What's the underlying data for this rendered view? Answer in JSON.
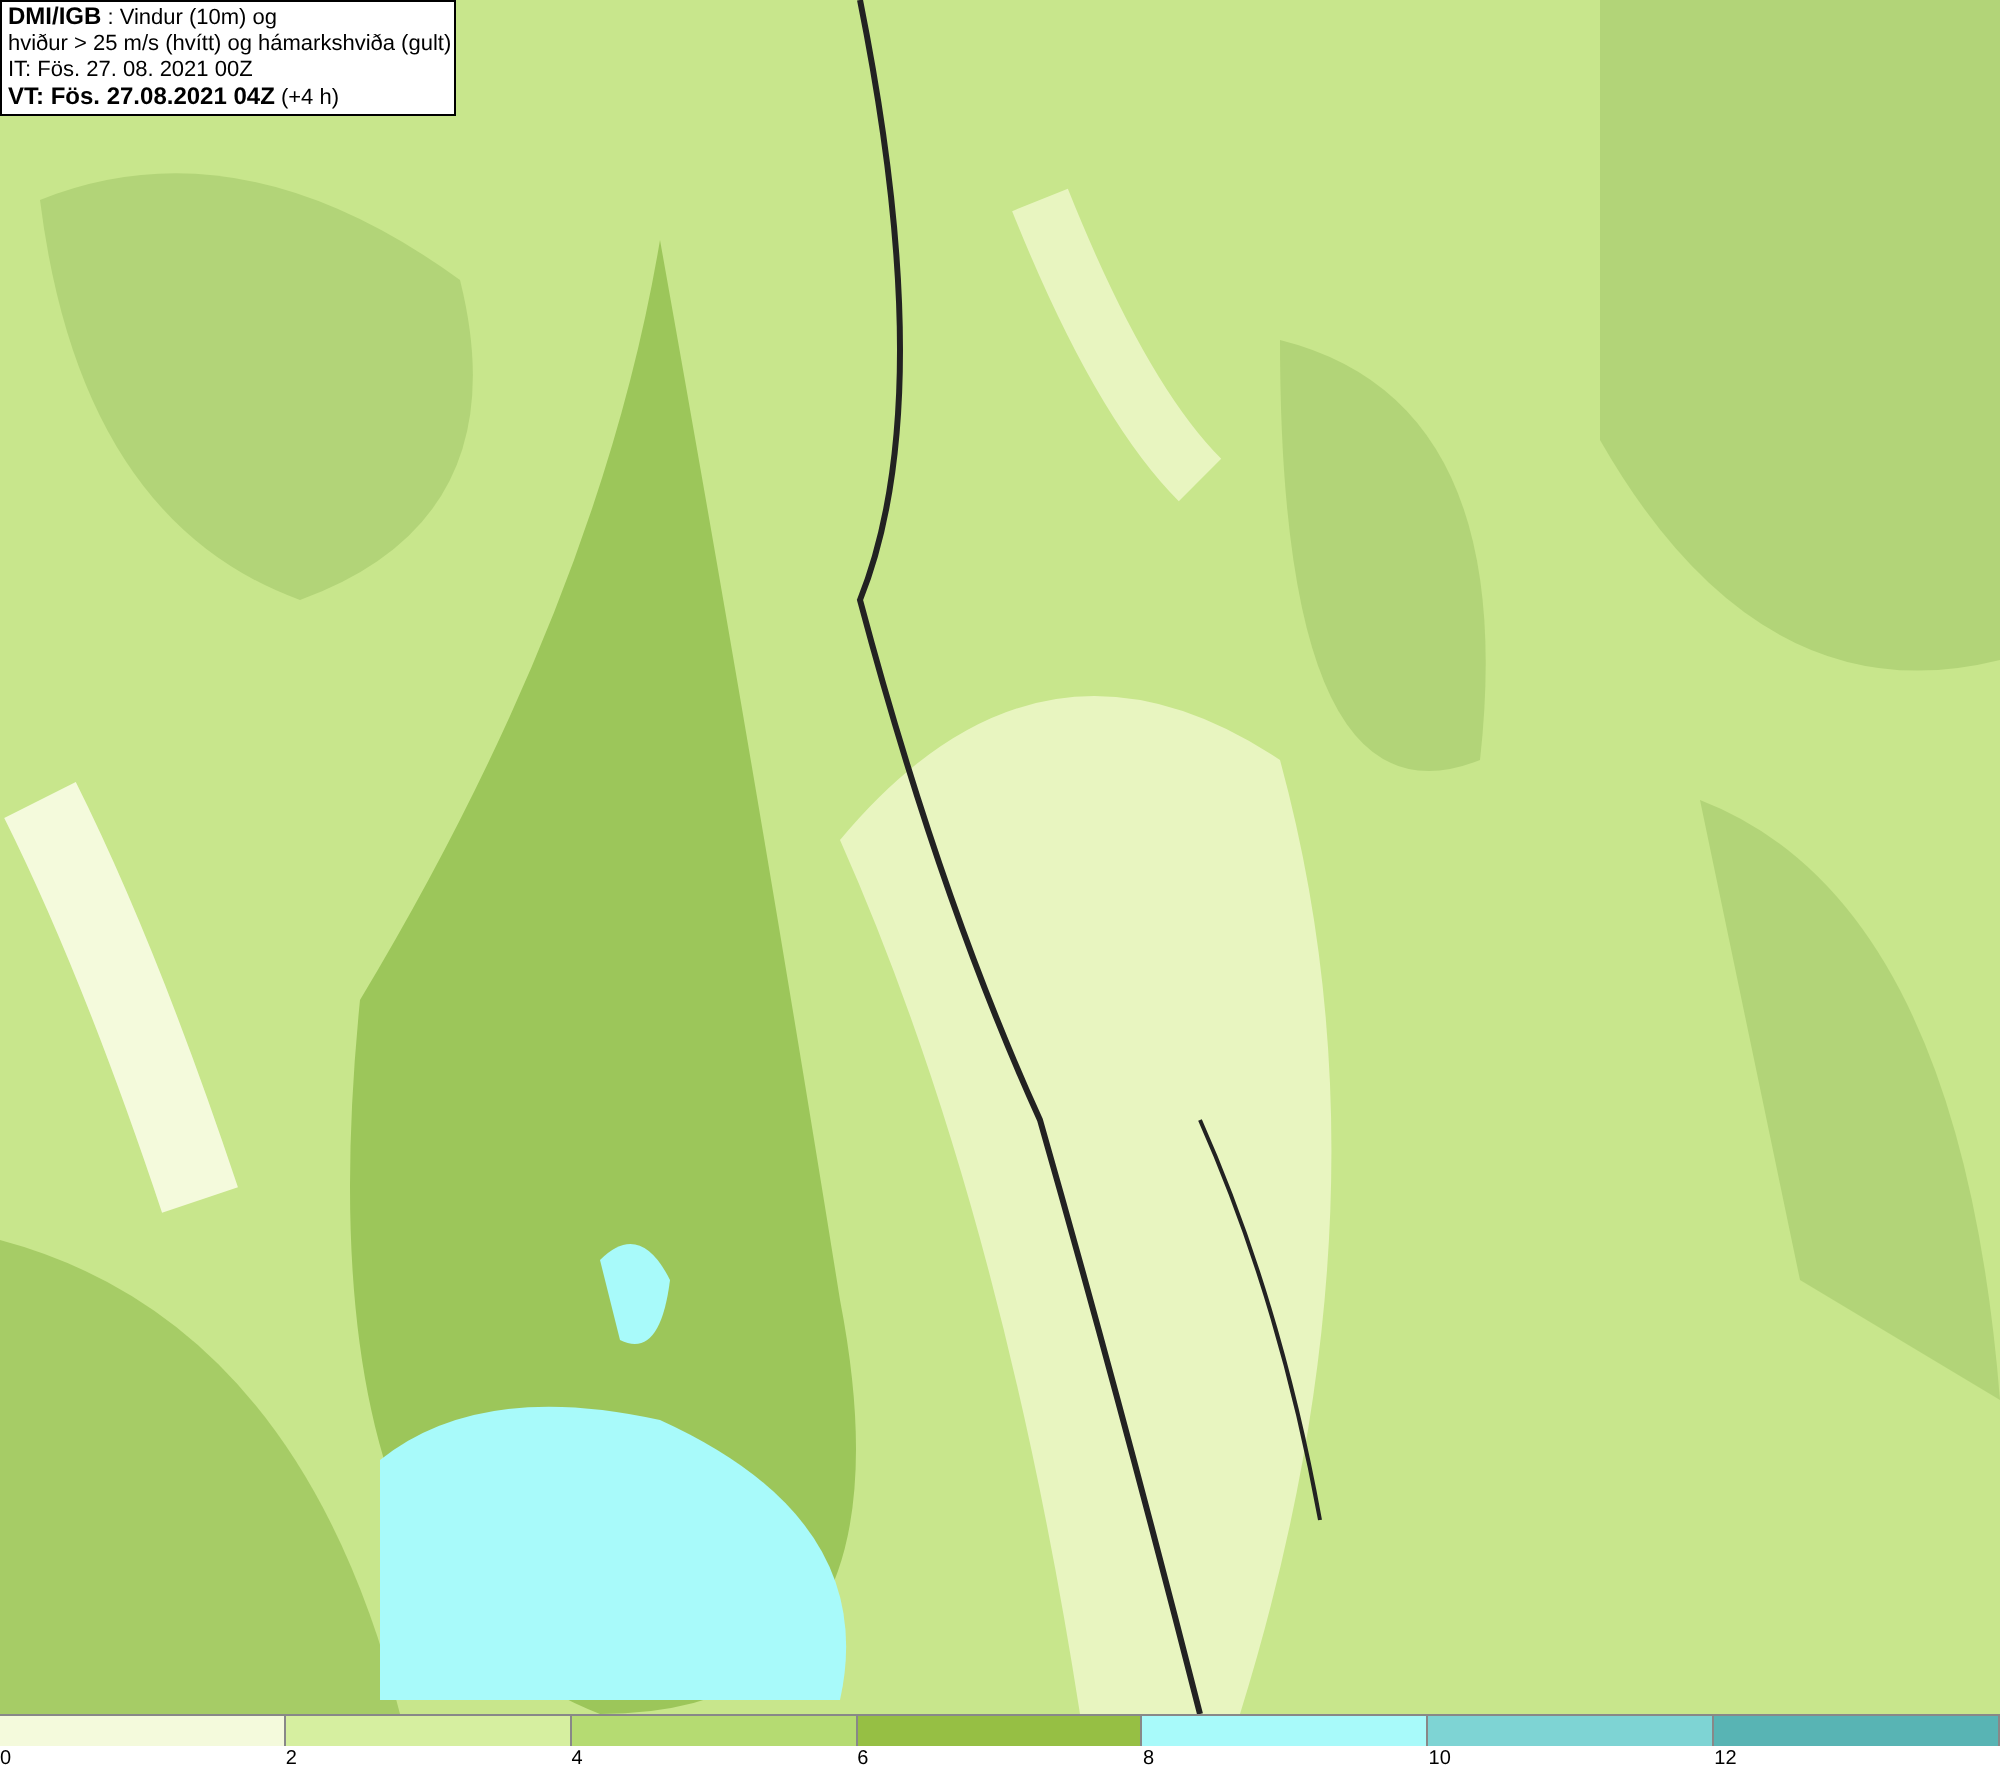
{
  "info_box": {
    "lines": [
      "**DMI/IGB** : Vindur (10m) og",
      "hviður > 25 m/s (hvítt) og hámarkshviða (gult)",
      "IT: Fös. 27. 08. 2021 00Z",
      "**VT: Fös. 27.08.2021 04Z** (+4 h)"
    ]
  },
  "color_scale": {
    "swatches": [
      {
        "color": "#f4fadc"
      },
      {
        "color": "#d6efa0"
      },
      {
        "color": "#b5db72"
      },
      {
        "color": "#96bf44"
      },
      {
        "color": "#a8fafa"
      },
      {
        "color": "#7ed4d4"
      },
      {
        "color": "#58b4b4"
      }
    ],
    "ticks": [
      "0",
      "2",
      "4",
      "6",
      "8",
      "10",
      "12"
    ]
  }
}
